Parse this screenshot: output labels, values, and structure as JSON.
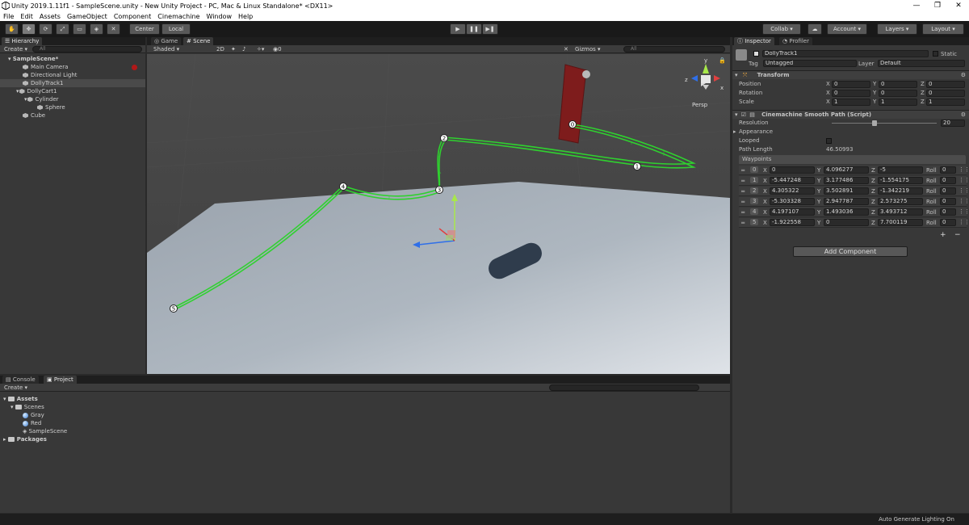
{
  "window": {
    "title": "Unity 2019.1.11f1 - SampleScene.unity - New Unity Project - PC, Mac & Linux Standalone* <DX11>",
    "minimize": "—",
    "maximize": "❐",
    "close": "✕"
  },
  "menu": [
    "File",
    "Edit",
    "Assets",
    "GameObject",
    "Component",
    "Cinemachine",
    "Window",
    "Help"
  ],
  "toolbar": {
    "tools": [
      "hand-tool",
      "move-tool",
      "rotate-tool",
      "scale-tool",
      "rect-tool",
      "transform-tool",
      "custom-tool"
    ],
    "tool_glyphs": [
      "✋",
      "✥",
      "⟳",
      "⤢",
      "▭",
      "◈",
      "✕"
    ],
    "pivot_mode": "Center",
    "pivot_rotation": "Local",
    "play": "▶",
    "pause": "❚❚",
    "step": "▶❚",
    "collab": "Collab",
    "account": "Account",
    "layers": "Layers",
    "layout": "Layout"
  },
  "hierarchy": {
    "tab": "Hierarchy",
    "create": "Create",
    "search_placeholder": "All",
    "scene": "SampleScene*",
    "items": [
      "Main Camera",
      "Directional Light",
      "DollyTrack1",
      "DollyCart1",
      "Cylinder",
      "Sphere",
      "Cube"
    ]
  },
  "scene_view": {
    "tab_game": "Game",
    "tab_scene": "Scene",
    "shading": "Shaded",
    "mode_2d": "2D",
    "fx_count": "0",
    "gizmos": "Gizmos",
    "search_placeholder": "All",
    "persp": "Persp",
    "axis_x": "x",
    "axis_y": "y",
    "axis_z": "z",
    "waypoint_labels": [
      "0",
      "1",
      "2",
      "3",
      "4",
      "5"
    ]
  },
  "project": {
    "tab_console": "Console",
    "tab_project": "Project",
    "create": "Create",
    "tree": {
      "assets": "Assets",
      "scenes": "Scenes",
      "gray": "Gray",
      "red": "Red",
      "sample_scene": "SampleScene",
      "packages": "Packages"
    }
  },
  "inspector": {
    "tab_inspector": "Inspector",
    "tab_profiler": "Profiler",
    "object_name": "DollyTrack1",
    "static_label": "Static",
    "tag_label": "Tag",
    "tag_value": "Untagged",
    "layer_label": "Layer",
    "layer_value": "Default",
    "transform": {
      "title": "Transform",
      "rows": [
        {
          "label": "Position",
          "x": "0",
          "y": "0",
          "z": "0"
        },
        {
          "label": "Rotation",
          "x": "0",
          "y": "0",
          "z": "0"
        },
        {
          "label": "Scale",
          "x": "1",
          "y": "1",
          "z": "1"
        }
      ]
    },
    "path": {
      "title": "Cinemachine Smooth Path (Script)",
      "resolution_label": "Resolution",
      "resolution_value": "20",
      "resolution_fraction": 0.4,
      "appearance_label": "Appearance",
      "looped_label": "Looped",
      "path_length_label": "Path Length",
      "path_length_value": "46.50993",
      "waypoints_label": "Waypoints",
      "waypoints": [
        {
          "i": "0",
          "x": "0",
          "y": "4.096277",
          "z": "-5",
          "roll": "0"
        },
        {
          "i": "1",
          "x": "-5.447248",
          "y": "3.177486",
          "z": "-1.554175",
          "roll": "0"
        },
        {
          "i": "2",
          "x": "4.305322",
          "y": "3.502891",
          "z": "-1.342219",
          "roll": "0"
        },
        {
          "i": "3",
          "x": "-5.303328",
          "y": "2.947787",
          "z": "2.573275",
          "roll": "0"
        },
        {
          "i": "4",
          "x": "4.197107",
          "y": "1.493036",
          "z": "3.493712",
          "roll": "0"
        },
        {
          "i": "5",
          "x": "-1.922558",
          "y": "0",
          "z": "7.700119",
          "roll": "0"
        }
      ],
      "roll_label": "Roll",
      "add_symbol": "+",
      "remove_symbol": "−"
    },
    "add_component": "Add Component"
  },
  "status": {
    "text": "Auto Generate Lighting On"
  },
  "colors": {
    "path_green": "#2fd12f",
    "red_block": "#8a1f1f",
    "ground": "#a9b2bc",
    "sky_dark": "#4a4a4a"
  }
}
